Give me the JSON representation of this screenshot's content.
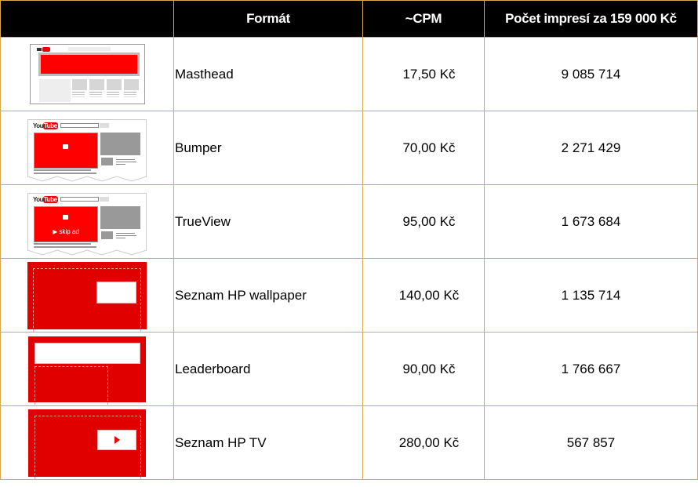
{
  "table": {
    "headers": {
      "preview": "",
      "format": "Formát",
      "cpm": "~CPM",
      "impressions": "Počet impresí za 159 000 Kč"
    },
    "rows": [
      {
        "format": "Masthead",
        "cpm": "17,50 Kč",
        "impressions": "9 085 714",
        "thumbnail": "youtube-masthead-preview"
      },
      {
        "format": "Bumper",
        "cpm": "70,00 Kč",
        "impressions": "2 271 429",
        "thumbnail": "youtube-bumper-preview"
      },
      {
        "format": "TrueView",
        "cpm": "95,00 Kč",
        "impressions": "1 673 684",
        "thumbnail": "youtube-trueview-preview",
        "skip_label": "▶ skip ad"
      },
      {
        "format": "Seznam HP wallpaper",
        "cpm": "140,00 Kč",
        "impressions": "1 135 714",
        "thumbnail": "seznam-wallpaper-preview"
      },
      {
        "format": "Leaderboard",
        "cpm": "90,00 Kč",
        "impressions": "1 766 667",
        "thumbnail": "leaderboard-preview"
      },
      {
        "format": "Seznam HP TV",
        "cpm": "280,00 Kč",
        "impressions": "567 857",
        "thumbnail": "seznam-tv-preview"
      }
    ]
  },
  "youtube_logo": {
    "you": "You",
    "tube": "Tube"
  },
  "colors": {
    "header_bg": "#000000",
    "grid": "#d6a94a",
    "ad_red": "#e00000"
  }
}
